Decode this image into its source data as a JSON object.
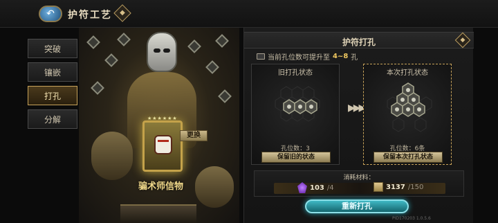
{
  "header": {
    "title": "护符工艺",
    "back_icon": "back-arrow-icon",
    "help_icon": "info-diamond-icon"
  },
  "tabs": [
    {
      "label": "突破",
      "active": false
    },
    {
      "label": "镶嵌",
      "active": false
    },
    {
      "label": "打孔",
      "active": true
    },
    {
      "label": "分解",
      "active": false
    }
  ],
  "item": {
    "name": "骗术师信物",
    "replace_label": "更换",
    "stars": "★★★★★★"
  },
  "panel": {
    "title": "护符打孔",
    "hint_prefix": "当前孔位数可提升至",
    "hint_range": "4~8",
    "hint_suffix": "孔",
    "old_state": {
      "label": "旧打孔状态",
      "count_label": "孔位数：3",
      "holes": 3,
      "keep_label": "保留旧的状态"
    },
    "new_state": {
      "label": "本次打孔状态",
      "count_label": "孔位数：6条",
      "holes": 6,
      "keep_label": "保留本次打孔状态"
    },
    "cost": {
      "title": "消耗材料：",
      "materials": [
        {
          "icon": "crystal-icon",
          "have": "103",
          "need": "/4"
        },
        {
          "icon": "scroll-icon",
          "have": "3137",
          "need": "/150"
        }
      ]
    },
    "rebore_label": "重新打孔",
    "version": "PID170203  1.0.5.6"
  }
}
